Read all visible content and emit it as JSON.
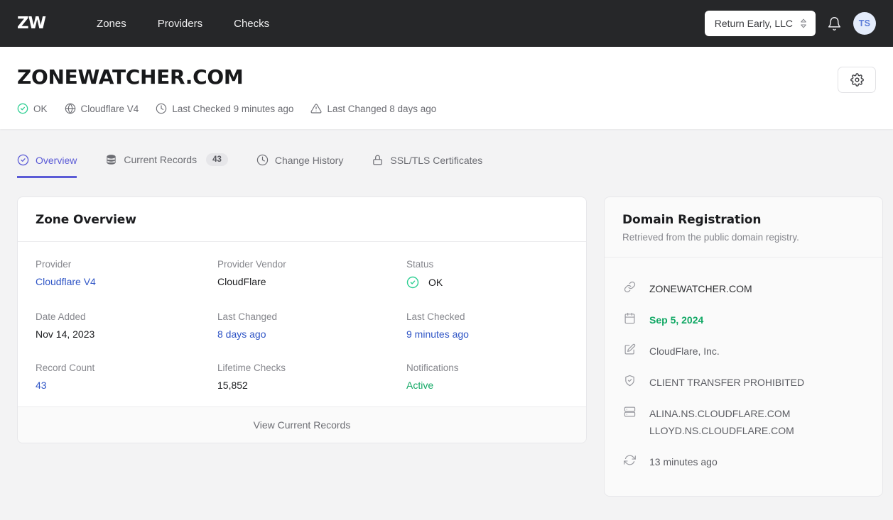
{
  "nav": {
    "logo": "ZW",
    "links": [
      {
        "label": "Zones"
      },
      {
        "label": "Providers"
      },
      {
        "label": "Checks"
      }
    ],
    "org_select": {
      "value": "Return Early, LLC",
      "icon": "chevron-updown-icon"
    },
    "notifications_icon": "bell-icon",
    "avatar_initials": "TS"
  },
  "header": {
    "title": "ZONEWATCHER.COM",
    "settings_icon": "gear-icon",
    "meta": [
      {
        "icon": "check-circle-icon",
        "label": "OK"
      },
      {
        "icon": "globe-icon",
        "label": "Cloudflare V4"
      },
      {
        "icon": "clock-icon",
        "label": "Last Checked 9 minutes ago"
      },
      {
        "icon": "warning-triangle-icon",
        "label": "Last Changed 8 days ago"
      }
    ]
  },
  "tabs": [
    {
      "label": "Overview",
      "icon": "check-circle-icon",
      "active": true
    },
    {
      "label": "Current Records",
      "icon": "database-icon",
      "badge": "43",
      "active": false
    },
    {
      "label": "Change History",
      "icon": "clock-icon",
      "active": false
    },
    {
      "label": "SSL/TLS Certificates",
      "icon": "lock-icon",
      "active": false
    }
  ],
  "zone_overview": {
    "title": "Zone Overview",
    "fields": [
      {
        "label": "Provider",
        "value": "Cloudflare V4",
        "style": "link"
      },
      {
        "label": "Provider Vendor",
        "value": "CloudFlare",
        "style": "plain"
      },
      {
        "label": "Status",
        "value": "OK",
        "style": "status"
      },
      {
        "label": "Date Added",
        "value": "Nov 14, 2023",
        "style": "plain"
      },
      {
        "label": "Last Changed",
        "value": "8 days ago",
        "style": "link"
      },
      {
        "label": "Last Checked",
        "value": "9 minutes ago",
        "style": "link"
      },
      {
        "label": "Record Count",
        "value": "43",
        "style": "link"
      },
      {
        "label": "Lifetime Checks",
        "value": "15,852",
        "style": "plain"
      },
      {
        "label": "Notifications",
        "value": "Active",
        "style": "green"
      }
    ],
    "footer_label": "View Current Records"
  },
  "domain_registration": {
    "title": "Domain Registration",
    "subtitle": "Retrieved from the public domain registry.",
    "rows": [
      {
        "icon": "link-icon",
        "text": "ZONEWATCHER.COM",
        "style": "plain"
      },
      {
        "icon": "calendar-icon",
        "text": "Sep 5, 2024",
        "style": "green"
      },
      {
        "icon": "pencil-icon",
        "text": "CloudFlare, Inc.",
        "style": "muted"
      },
      {
        "icon": "shield-check-icon",
        "text": "CLIENT TRANSFER PROHIBITED",
        "style": "muted"
      },
      {
        "icon": "server-icon",
        "text": "ALINA.NS.CLOUDFLARE.COM\nLLOYD.NS.CLOUDFLARE.COM",
        "style": "muted"
      },
      {
        "icon": "refresh-icon",
        "text": "13 minutes ago",
        "style": "muted"
      }
    ]
  },
  "colors": {
    "nav_bg": "#262729",
    "accent": "#5b5bd6",
    "link": "#2f55c6",
    "green": "#12a865",
    "page_bg": "#f3f3f4"
  }
}
